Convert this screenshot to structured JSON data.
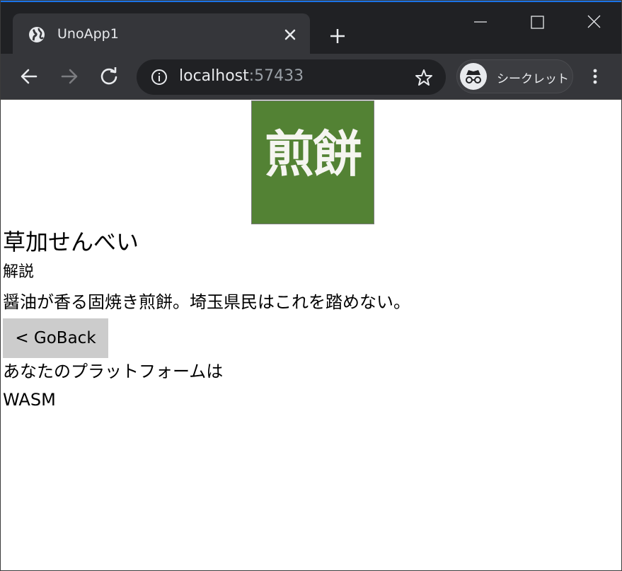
{
  "browser": {
    "tab_title": "UnoApp1",
    "url_host": "localhost",
    "url_port": ":57433",
    "incognito_label": "シークレット"
  },
  "icons": {
    "favicon": "globe-icon",
    "tab_close": "close-icon",
    "new_tab": "plus-icon",
    "back": "arrow-left-icon",
    "forward": "arrow-right-icon",
    "reload": "reload-icon",
    "info": "info-icon",
    "bookmark": "star-icon",
    "incognito": "incognito-icon",
    "menu": "kebab-menu-icon"
  },
  "app": {
    "logo_text": "煎餅",
    "logo_color": "#538234",
    "title": "草加せんべい",
    "section_label": "解説",
    "description": "醤油が香る固焼き煎餅。埼玉県民はこれを踏めない。",
    "goback_label": "< GoBack",
    "platform_label": "あなたのプラットフォームは",
    "platform_value": "WASM"
  }
}
